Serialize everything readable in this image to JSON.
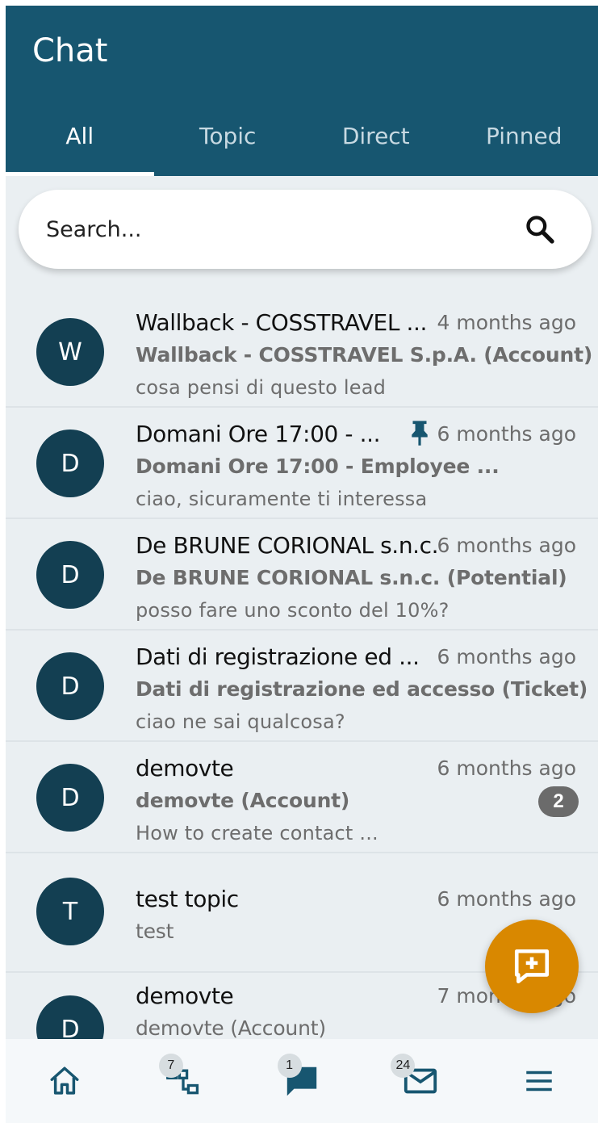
{
  "header": {
    "title": "Chat"
  },
  "tabs": [
    {
      "label": "All",
      "active": true
    },
    {
      "label": "Topic",
      "active": false
    },
    {
      "label": "Direct",
      "active": false
    },
    {
      "label": "Pinned",
      "active": false
    }
  ],
  "search": {
    "placeholder": "Search...",
    "icon": "search-icon"
  },
  "chats": [
    {
      "initial": "W",
      "name": "Wallback - COSSTRAVEL ...",
      "time": "4 months ago",
      "subtitle": "Wallback - COSSTRAVEL S.p.A. (Account)",
      "message": "cosa pensi di questo lead"
    },
    {
      "initial": "D",
      "name": "Domani Ore 17:00 - ...",
      "time": "6 months ago",
      "subtitle": "Domani Ore 17:00 - Employee ...",
      "message": "ciao, sicuramente ti interessa",
      "pinned": true,
      "pin_icon": "pin-icon"
    },
    {
      "initial": "D",
      "name": "De BRUNE CORIONAL s.n.c.",
      "time": "6 months ago",
      "subtitle": "De BRUNE CORIONAL s.n.c. (Potential)",
      "message": "posso fare uno sconto del 10%?"
    },
    {
      "initial": "D",
      "name": "Dati di registrazione ed ...",
      "time": "6 months ago",
      "subtitle": "Dati di registrazione ed accesso (Ticket)",
      "message": "ciao ne sai qualcosa?"
    },
    {
      "initial": "D",
      "name": "demovte",
      "time": "6 months ago",
      "subtitle": "demovte (Account)",
      "message": "How to create contact ...",
      "unread": "2"
    },
    {
      "initial": "T",
      "name": "test topic",
      "time": "6 months ago",
      "subtitle": "test",
      "message": ""
    },
    {
      "initial": "D",
      "name": "demovte",
      "time": "7 months ago",
      "subtitle": "demovte (Account)",
      "message": ""
    }
  ],
  "fab": {
    "icon": "new-chat-icon"
  },
  "bottom_nav": [
    {
      "icon": "home-icon",
      "badge": ""
    },
    {
      "icon": "hierarchy-icon",
      "badge": "7"
    },
    {
      "icon": "chat-icon",
      "badge": "1",
      "active": true
    },
    {
      "icon": "mail-icon",
      "badge": "24"
    },
    {
      "icon": "menu-icon",
      "badge": ""
    }
  ],
  "colors": {
    "header": "#175670",
    "avatar": "#133f52",
    "fab": "#d98800",
    "background": "#eaeff2"
  }
}
